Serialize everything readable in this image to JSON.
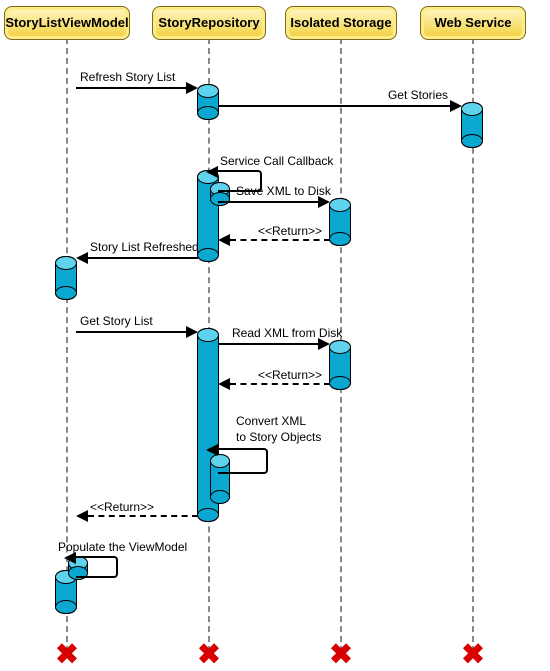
{
  "participants": {
    "vm": {
      "label": "StoryListViewModel"
    },
    "repo": {
      "label": "StoryRepository"
    },
    "storage": {
      "label": "Isolated Storage"
    },
    "web": {
      "label": "Web Service"
    }
  },
  "messages": {
    "refresh_story_list": {
      "text": "Refresh Story List"
    },
    "get_stories": {
      "text": "Get Stories"
    },
    "service_callback": {
      "text": "Service Call Callback"
    },
    "save_xml_to_disk": {
      "text": "Save XML to Disk"
    },
    "return1": {
      "text": "<<Return>>"
    },
    "story_list_refreshed": {
      "text": "Story List Refreshed"
    },
    "get_story_list": {
      "text": "Get Story List"
    },
    "read_xml_from_disk": {
      "text": "Read XML from Disk"
    },
    "return2": {
      "text": "<<Return>>"
    },
    "convert_xml_line1": {
      "text": "Convert XML"
    },
    "convert_xml_line2": {
      "text": "to Story Objects"
    },
    "return3": {
      "text": "<<Return>>"
    },
    "populate_viewmodel": {
      "text": "Populate the ViewModel"
    }
  }
}
